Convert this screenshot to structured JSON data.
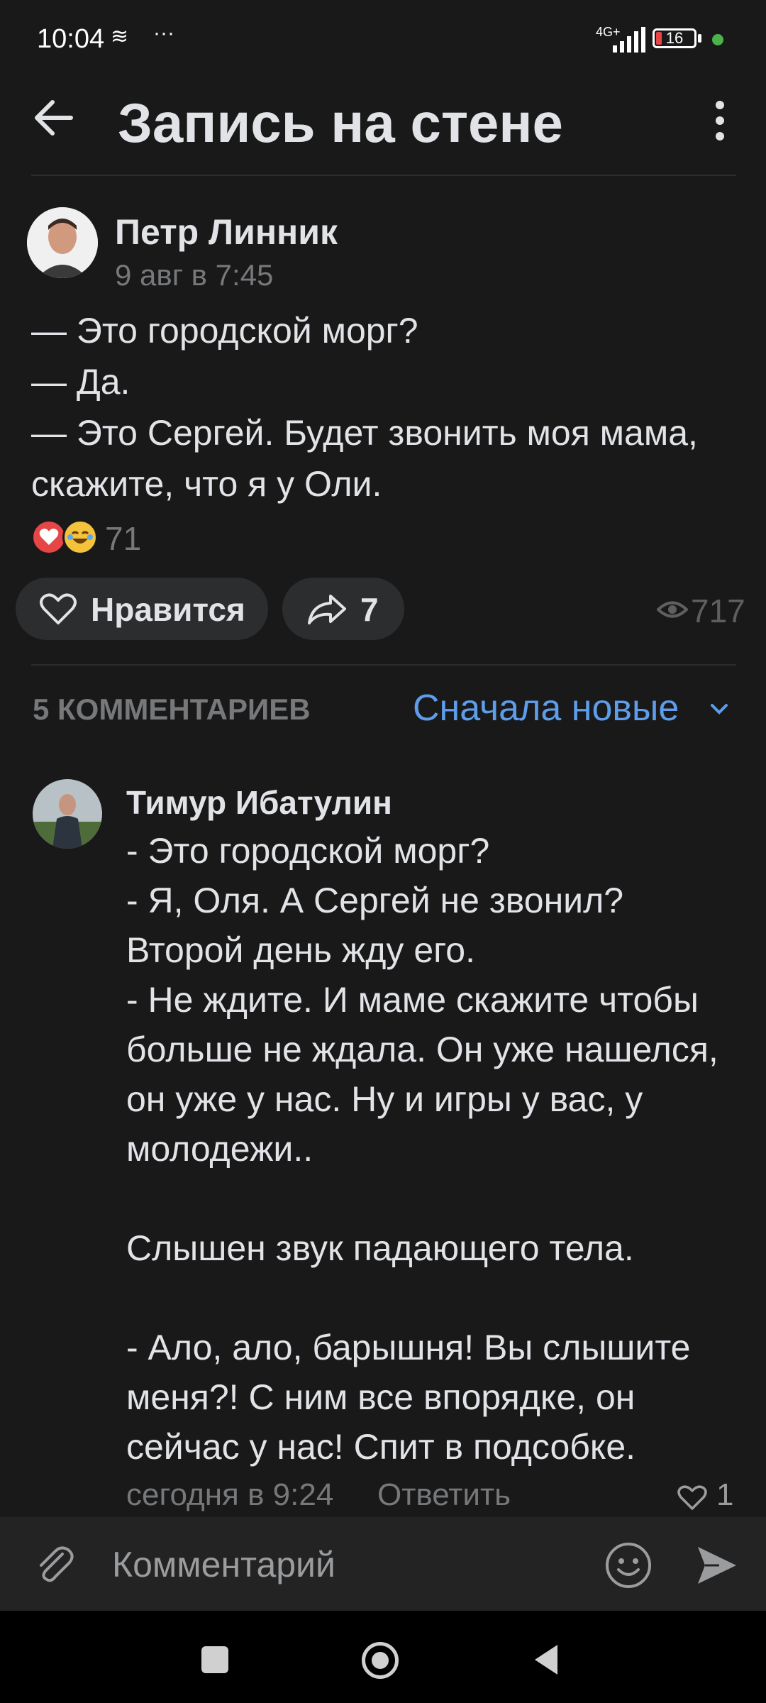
{
  "status_bar": {
    "time": "10:04",
    "network": "4G+",
    "battery": "16"
  },
  "header": {
    "title": "Запись на стене"
  },
  "post": {
    "author": "Петр Линник",
    "date": "9 авг в 7:45",
    "text": "— Это городской морг?\n— Да.\n— Это Сергей. Будет звонить моя мама, скажите, что я у Оли.",
    "reactions_count": "71",
    "like_label": "Нравится",
    "shares_count": "7",
    "views_count": "717"
  },
  "comments_header": {
    "count_label": "5 КОММЕНТАРИЕВ",
    "sort_label": "Сначала новые"
  },
  "comments": [
    {
      "author": "Тимур Ибатулин",
      "text": "- Это городской морг?\n- Я, Оля. А Сергей не звонил? Второй день жду его.\n- Не ждите. И маме скажите чтобы больше не ждала. Он уже нашелся, он уже у нас. Ну и игры у вас, у молодежи..\n\nСлышен звук падающего тела.\n\n- Ало, ало, барышня! Вы слышите меня?! С ним все впорядке, он сейчас у нас! Спит в подсобке.",
      "date": "сегодня в 9:24",
      "reply_label": "Ответить",
      "likes": "1"
    }
  ],
  "composer": {
    "placeholder": "Комментарий"
  },
  "colors": {
    "background": "#19191a",
    "accent": "#5d9de9",
    "text": "#e1e3e6",
    "secondary": "#76787a"
  }
}
